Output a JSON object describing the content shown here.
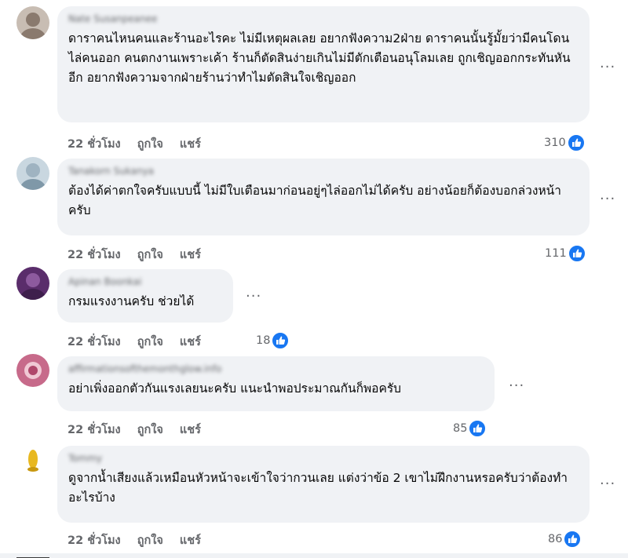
{
  "comments": [
    {
      "author": "Nate Susanpeanee",
      "text": "ดาราคนไหนคนและร้านอะไรคะ ไม่มีเหตุผลเลย อยากฟังความ2ฝ่าย ดาราคนนั้นรู้มั้ยว่ามีคนโดนไล่คนออก คนตกงานเพราะเค้า ร้านก็ตัดสินง่ายเกินไม่มีตักเตือนอนุโลมเลย ถูกเชิญออกกระทันหันอีก อยากฟังความจากฝ่ายร้านว่าทำไมตัดสินใจเชิญออก",
      "time": "22 ชั่วโมง",
      "like": "ถูกใจ",
      "share": "แชร์",
      "likes": "310",
      "avatar_color": "#8a7a6e"
    },
    {
      "author": "Tanakorn Sukanya",
      "text": "ต้องได้ค่าตกใจครับแบบนี้ ไม่มีใบเตือนมาก่อนอยู่ๆไล่ออกไม่ได้ครับ อย่างน้อยก็ต้องบอกล่วงหน้าครับ",
      "time": "22 ชั่วโมง",
      "like": "ถูกใจ",
      "share": "แชร์",
      "likes": "111",
      "avatar_color": "#a8bcc9"
    },
    {
      "author": "Apinan Boonkai",
      "text": "กรมแรงงานครับ ช่วยได้",
      "time": "22 ชั่วโมง",
      "like": "ถูกใจ",
      "share": "แชร์",
      "likes": "18",
      "avatar_color": "#6b3a7a"
    },
    {
      "author": "affirmationsofthemonthglow.info",
      "text": "อย่าเพิ่งออกตัวกันแรงเลยนะครับ แนะนำพอประมาณกันก็พอครับ",
      "time": "22 ชั่วโมง",
      "like": "ถูกใจ",
      "share": "แชร์",
      "likes": "85",
      "avatar_color": "#b0476b"
    },
    {
      "author": "Tommy",
      "text": "ดูจากน้ำเสียงแล้วเหมือนหัวหน้าจะเข้าใจว่ากวนเลย แต่งว่าข้อ 2 เขาไม่ฝึกงานหรอครับว่าต้องทำอะไรบ้าง",
      "time": "22 ชั่วโมง",
      "like": "ถูกใจ",
      "share": "แชร์",
      "likes": "86",
      "avatar_color": "#e0b020"
    }
  ],
  "more_label": "···",
  "like_icon_color": "#1877f2"
}
